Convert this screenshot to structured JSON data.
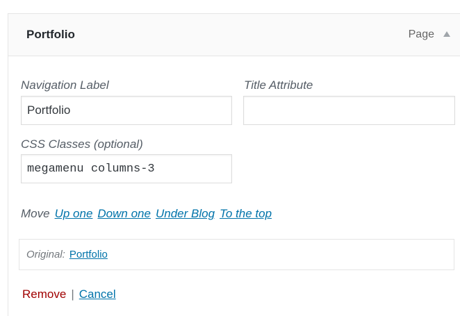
{
  "menu_item": {
    "title": "Portfolio",
    "type": "Page",
    "toggle_icon": "arrow-up-icon"
  },
  "fields": {
    "navigation_label": {
      "label": "Navigation Label",
      "value": "Portfolio"
    },
    "title_attribute": {
      "label": "Title Attribute",
      "value": ""
    },
    "css_classes": {
      "label": "CSS Classes (optional)",
      "value": "megamenu columns-3"
    }
  },
  "move": {
    "label": "Move",
    "links": [
      "Up one",
      "Down one",
      "Under Blog",
      "To the top"
    ]
  },
  "original": {
    "label": "Original:",
    "link": "Portfolio"
  },
  "actions": {
    "remove": "Remove",
    "separator": "|",
    "cancel": "Cancel"
  },
  "colors": {
    "link": "#0073aa",
    "remove": "#a00000",
    "border": "#e5e5e5",
    "header_bg": "#fafafa"
  }
}
